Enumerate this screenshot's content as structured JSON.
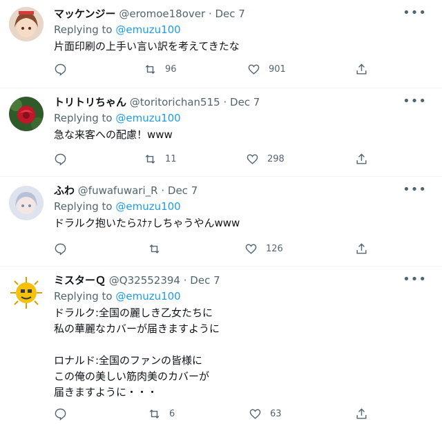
{
  "tweets": [
    {
      "name": "マッケンジー",
      "handle": "@eromoe18over",
      "sep": "·",
      "date": "Dec 7",
      "replying_prefix": "Replying to",
      "replying_handle": "@emuzu100",
      "text": "片面印刷の上手い言い訳を考えてきたな",
      "retweets": "96",
      "likes": "901",
      "avatar_color": "#c4755a"
    },
    {
      "name": "トリトリちゃん",
      "handle": "@toritorichan515",
      "sep": "·",
      "date": "Dec 7",
      "replying_prefix": "Replying to",
      "replying_handle": "@emuzu100",
      "text": "急な来客への配慮！www",
      "retweets": "11",
      "likes": "298",
      "avatar_color": "#c0182a"
    },
    {
      "name": "ふわ",
      "handle": "@fuwafuwari_R",
      "sep": "·",
      "date": "Dec 7",
      "replying_prefix": "Replying to",
      "replying_handle": "@emuzu100",
      "text": "ドラルク抱いたらｽﾅｧしちゃうやんwww",
      "retweets": "",
      "likes": "126",
      "avatar_color": "#c9cfe0"
    },
    {
      "name": "ミスターＱ",
      "handle": "@Q32552394",
      "sep": "·",
      "date": "Dec 7",
      "replying_prefix": "Replying to",
      "replying_handle": "@emuzu100",
      "text": "ドラルク:全国の麗しき乙女たちに\n私の華麗なカバーが届きますように\n\nロナルド:全国のファンの皆様に\nこの俺の美しい筋肉美のカバーが\n届きますように・・・",
      "retweets": "6",
      "likes": "63",
      "avatar_color": "#f4c20d"
    }
  ],
  "colors": {
    "link": "#1d9bf0",
    "muted": "#536471",
    "text": "#0f1419"
  },
  "icons": [
    "more-icon",
    "reply-icon",
    "retweet-icon",
    "like-icon",
    "share-icon"
  ]
}
